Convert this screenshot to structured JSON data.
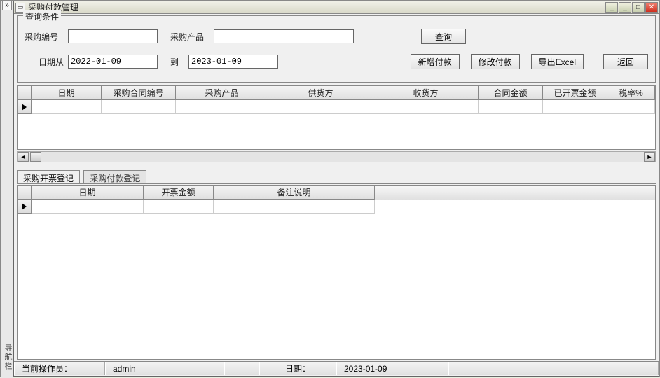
{
  "window": {
    "title": "采购付款管理",
    "left_gutter_label": "导航栏"
  },
  "query": {
    "group_label": "查询条件",
    "purchase_no_label": "采购编号",
    "purchase_no_value": "",
    "product_label": "采购产品",
    "product_value": "",
    "date_from_label": "日期从",
    "date_from_value": "2022-01-09",
    "date_to_label": "到",
    "date_to_value": "2023-01-09",
    "search_btn": "查询",
    "add_btn": "新增付款",
    "edit_btn": "修改付款",
    "export_btn": "导出Excel",
    "back_btn": "返回"
  },
  "grid_main": {
    "columns": [
      "日期",
      "采购合同编号",
      "采购产品",
      "供货方",
      "收货方",
      "合同金额",
      "已开票金额",
      "税率%"
    ]
  },
  "tabs": {
    "tab1": "采购开票登记",
    "tab2": "采购付款登记"
  },
  "grid_sub": {
    "columns": [
      "日期",
      "开票金额",
      "备注说明"
    ]
  },
  "status": {
    "operator_label": "当前操作员：",
    "operator_value": "admin",
    "date_label": "日期：",
    "date_value": "2023-01-09"
  }
}
